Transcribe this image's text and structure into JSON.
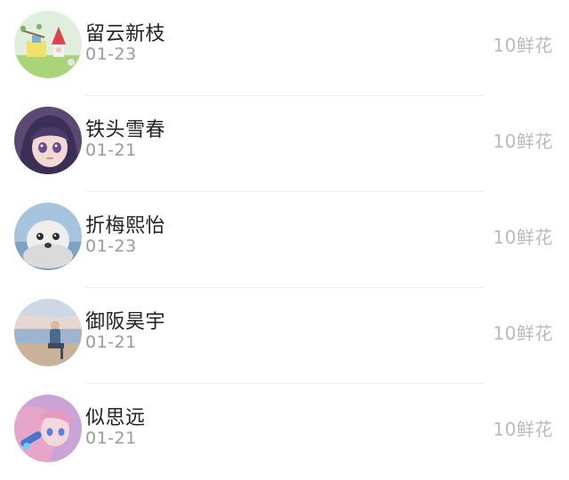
{
  "list": {
    "items": [
      {
        "name": "留云新枝",
        "date": "01-23",
        "gift": "10鲜花",
        "avatar_icon": "avatar-cartoon-gnome"
      },
      {
        "name": "铁头雪春",
        "date": "01-21",
        "gift": "10鲜花",
        "avatar_icon": "avatar-anime-girl"
      },
      {
        "name": "折梅熙怡",
        "date": "01-23",
        "gift": "10鲜花",
        "avatar_icon": "avatar-seal"
      },
      {
        "name": "御阪昊宇",
        "date": "01-21",
        "gift": "10鲜花",
        "avatar_icon": "avatar-person-sea"
      },
      {
        "name": "似思远",
        "date": "01-21",
        "gift": "10鲜花",
        "avatar_icon": "avatar-anime-pink"
      }
    ]
  },
  "colors": {
    "name": "#222222",
    "date": "#9a9a9a",
    "gift": "#b9b9b9"
  }
}
